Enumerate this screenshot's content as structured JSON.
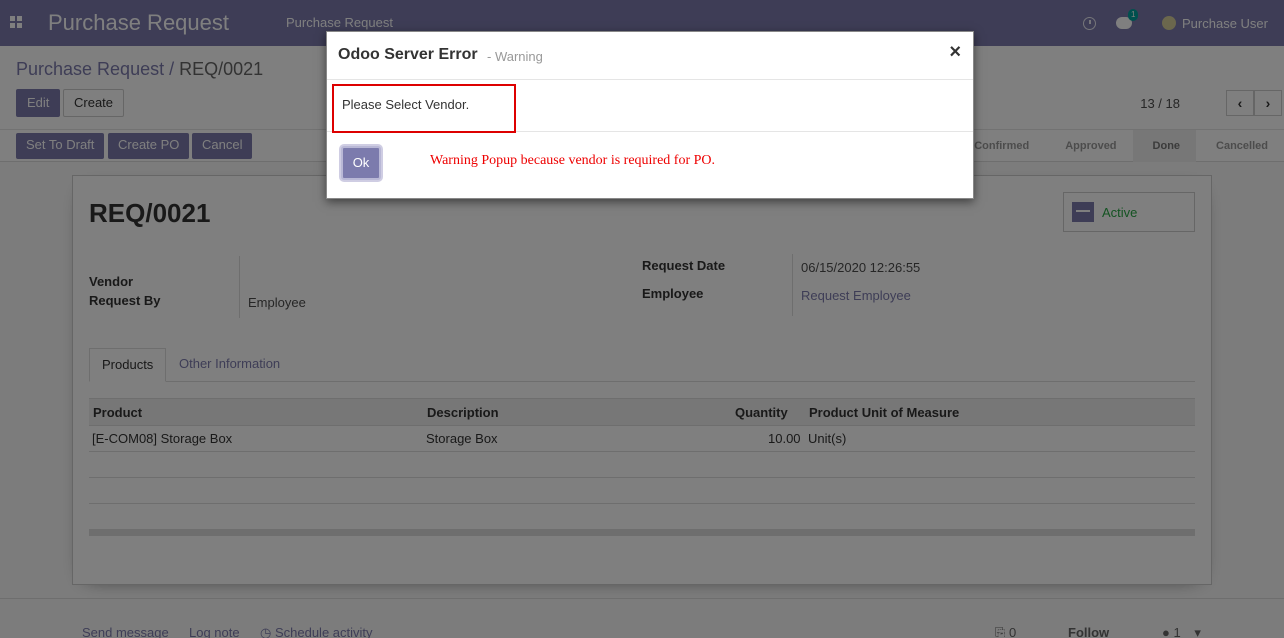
{
  "navbar": {
    "app_title": "Purchase Request",
    "menu_item": "Purchase Request",
    "chat_count": "1",
    "user_name": "Purchase User"
  },
  "control": {
    "breadcrumb_parent": "Purchase Request",
    "breadcrumb_separator": "/",
    "breadcrumb_current": "REQ/0021",
    "edit_label": "Edit",
    "create_label": "Create",
    "pager": "13 / 18"
  },
  "statusbar": {
    "buttons": [
      "Set To Draft",
      "Create PO",
      "Cancel"
    ],
    "stages": [
      "Confirmed",
      "Approved",
      "Done",
      "Cancelled"
    ],
    "active_stage": "Done"
  },
  "form": {
    "title": "REQ/0021",
    "active_label": "Active",
    "vendor_label": "Vendor",
    "vendor_value": "",
    "request_by_label": "Request By",
    "request_by_value": "Employee",
    "request_date_label": "Request Date",
    "request_date_value": "06/15/2020 12:26:55",
    "employee_label": "Employee",
    "employee_value": "Request Employee",
    "tabs": [
      "Products",
      "Other Information"
    ],
    "table": {
      "columns": [
        "Product",
        "Description",
        "Quantity",
        "Product Unit of Measure"
      ],
      "rows": [
        [
          "[E-COM08] Storage Box",
          "Storage Box",
          "10.00",
          "Unit(s)"
        ]
      ]
    }
  },
  "chatter": {
    "send_message": "Send message",
    "log_note": "Log note",
    "schedule_activity": "Schedule activity",
    "attachments": "0",
    "follow": "Follow",
    "followers": "1"
  },
  "modal": {
    "title": "Odoo Server Error",
    "subtitle": "- Warning",
    "close": "×",
    "message": "Please Select Vendor.",
    "ok_label": "Ok",
    "note": "Warning Popup because vendor is required for PO."
  },
  "colors": {
    "brand": "#7c7bad",
    "annotation": "#dd0000",
    "active_green": "#28a745"
  }
}
